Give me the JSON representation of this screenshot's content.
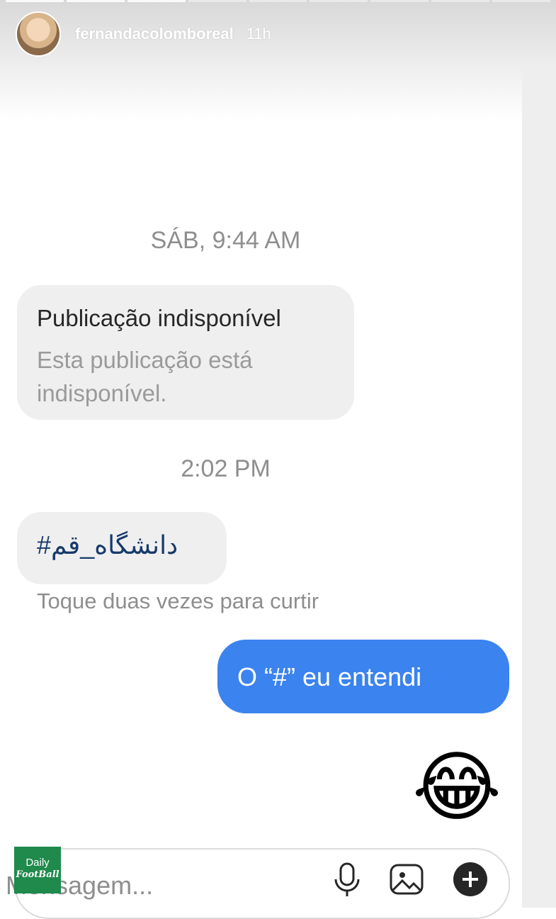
{
  "story": {
    "username": "fernandacolomboreal",
    "time_ago": "11h",
    "segments": 9,
    "active_segments": 3
  },
  "chat": {
    "timestamp_1": "SÁB, 9:44 AM",
    "unavailable_post": {
      "title": "Publicação indisponível",
      "subtitle": "Esta publicação está indisponível."
    },
    "timestamp_2": "2:02 PM",
    "received_message": "#دانشگاه_قم",
    "double_tap_hint": "Toque duas vezes para curtir",
    "sent_message": "O “#” eu entendi",
    "sent_emoji": "😂"
  },
  "composer": {
    "placeholder": "Mensagem..."
  },
  "watermark": {
    "line1": "Daily",
    "line2": "FootBall"
  },
  "colors": {
    "sent_bubble": "#3b83ee",
    "received_bubble": "#efefef",
    "badge": "#1f8a4c"
  }
}
